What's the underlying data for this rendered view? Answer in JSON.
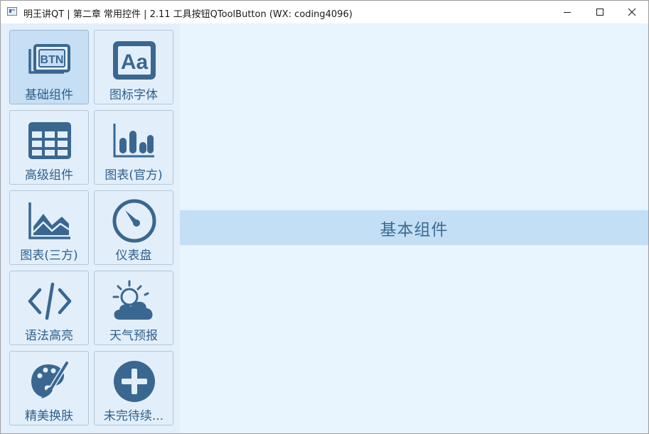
{
  "window": {
    "title": "明王讲QT | 第二章 常用控件 | 2.11 工具按钮QToolButton (WX: coding4096)",
    "controls": {
      "minimize": "minimize-icon",
      "maximize": "maximize-icon",
      "close": "close-icon"
    }
  },
  "sidebar": {
    "buttons": [
      {
        "label": "基础组件",
        "icon": "btn-icon",
        "active": true
      },
      {
        "label": "图标字体",
        "icon": "font-aa-icon",
        "active": false
      },
      {
        "label": "高级组件",
        "icon": "table-icon",
        "active": false
      },
      {
        "label": "图表(官方)",
        "icon": "bar-chart-icon",
        "active": false
      },
      {
        "label": "图表(三方)",
        "icon": "area-chart-icon",
        "active": false
      },
      {
        "label": "仪表盘",
        "icon": "gauge-icon",
        "active": false
      },
      {
        "label": "语法高亮",
        "icon": "code-icon",
        "active": false
      },
      {
        "label": "天气预报",
        "icon": "weather-icon",
        "active": false
      },
      {
        "label": "精美换肤",
        "icon": "palette-icon",
        "active": false
      },
      {
        "label": "未完待续...",
        "icon": "plus-circle-icon",
        "active": false
      }
    ],
    "btn_icon_text": "BTN",
    "font_icon_text": "Aa"
  },
  "content": {
    "label": "基本组件"
  },
  "colors": {
    "icon": "#3a6790",
    "sidebar_bg": "#e3effb",
    "button_bg": "#e2effb",
    "button_active_bg": "#c6dff5",
    "content_bg": "#e8f4fe",
    "band_bg": "#c3dff5",
    "label_text": "#2f5f8a"
  }
}
